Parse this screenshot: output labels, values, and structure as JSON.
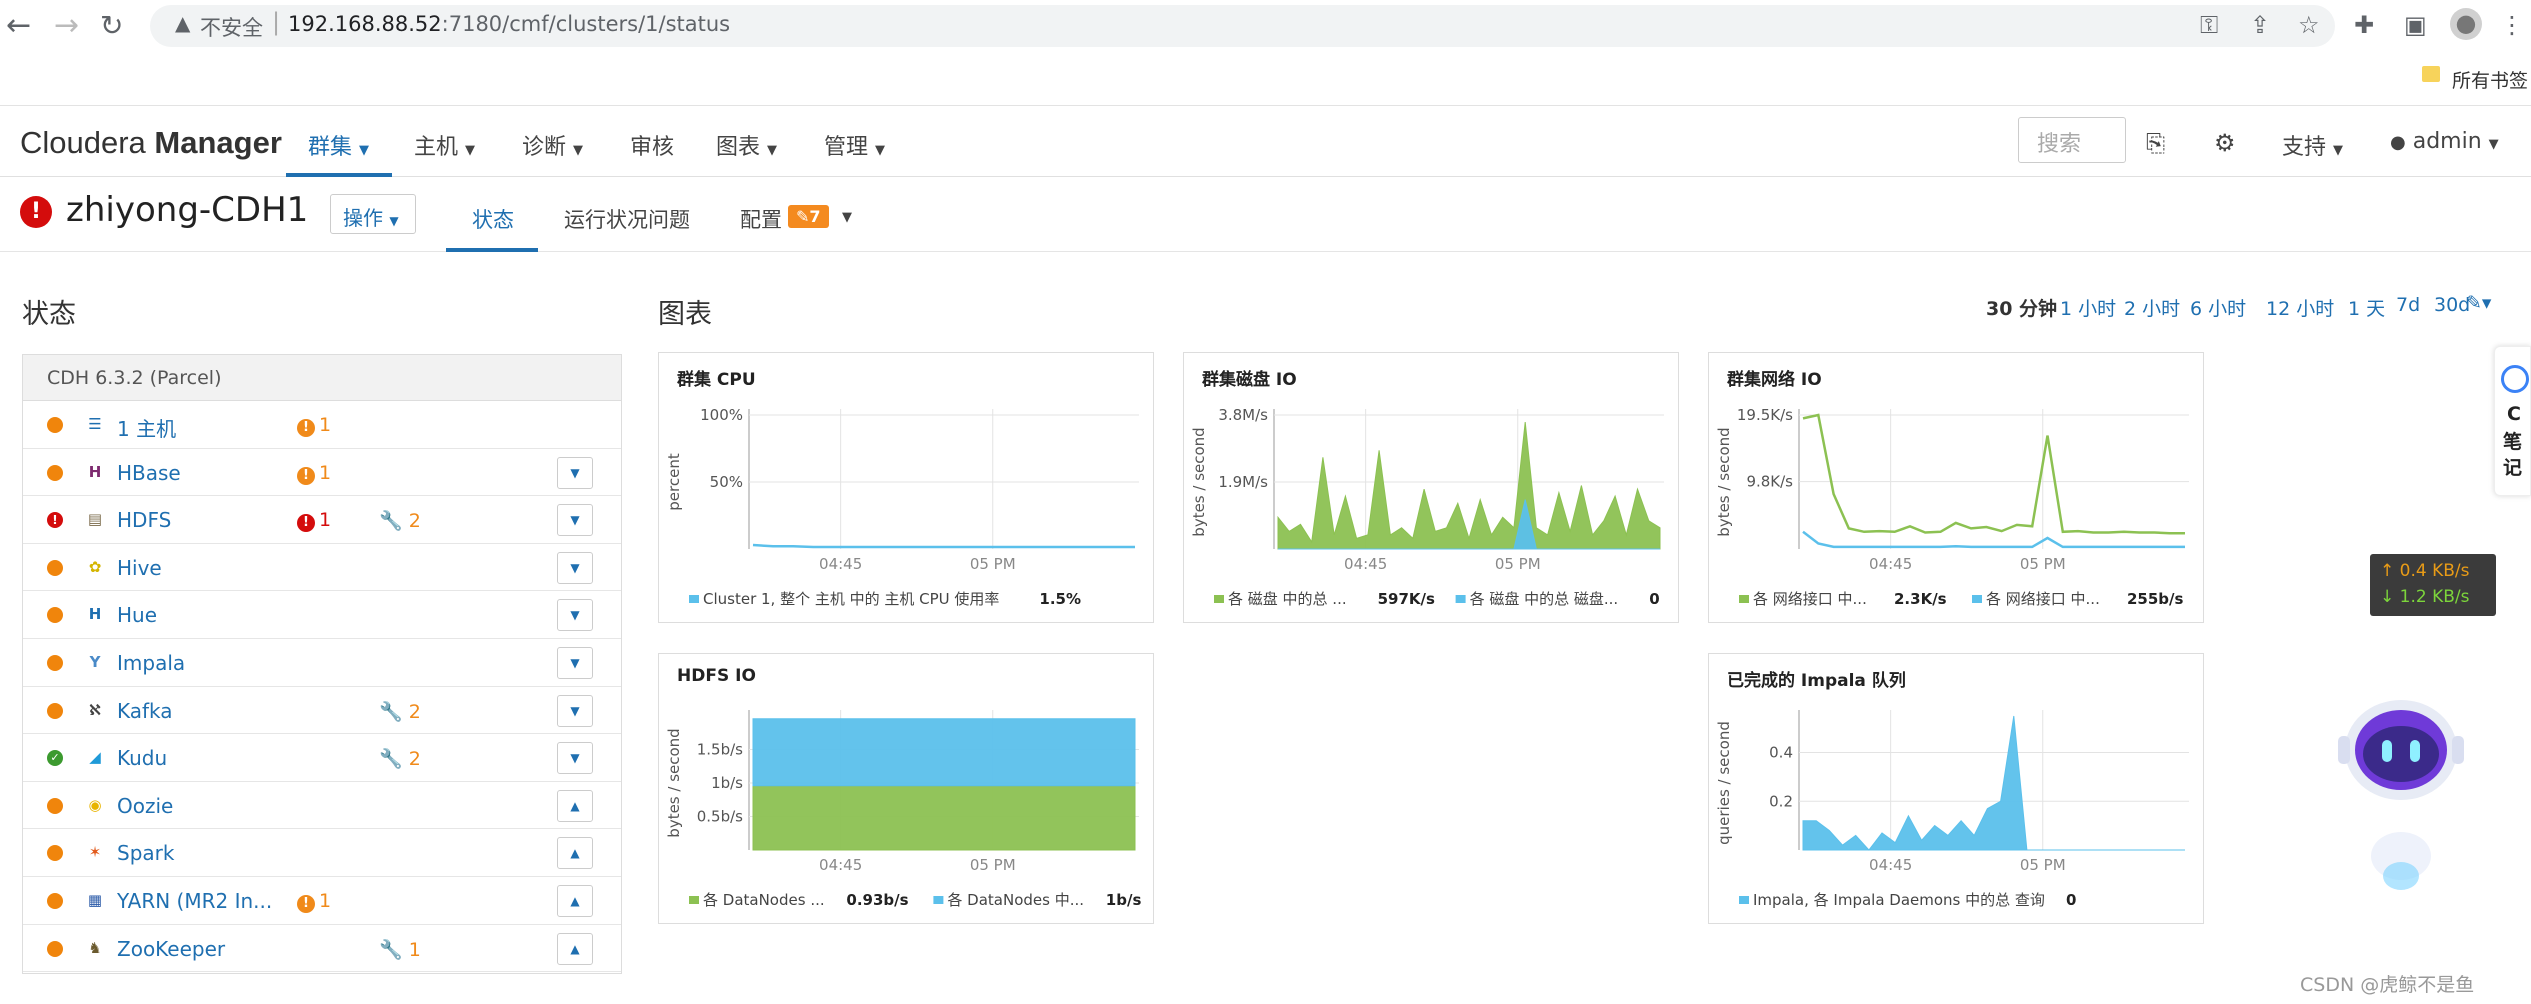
{
  "browser": {
    "security_label": "不安全",
    "url_host": "192.168.88.52",
    "url_path": ":7180/cmf/clusters/1/status",
    "bookmarks_label": "所有书签"
  },
  "topnav": {
    "brand_light": "Cloudera ",
    "brand_bold": "Manager",
    "items": [
      "群集",
      "主机",
      "诊断",
      "审核",
      "图表",
      "管理"
    ],
    "search_placeholder": "搜索",
    "support": "支持",
    "user": "admin"
  },
  "header": {
    "cluster_name": "zhiyong-CDH1",
    "actions_label": "操作",
    "tabs": [
      "状态",
      "运行状况问题",
      "配置"
    ],
    "config_badge": "7"
  },
  "status": {
    "title": "状态",
    "parcel": "CDH 6.3.2 (Parcel)",
    "services": [
      {
        "name": "1 主机",
        "dot": "#f0850c",
        "icon": "list-icon",
        "icon_color": "#1f6fb0",
        "alert": "1",
        "alert_type": "orange",
        "cfg": "",
        "btn": "",
        "icon_glyph": "☰"
      },
      {
        "name": "HBase",
        "dot": "#f0850c",
        "icon": "hbase-icon",
        "icon_color": "#7d2a6f",
        "alert": "1",
        "alert_type": "orange",
        "cfg": "",
        "btn": "▼",
        "icon_glyph": "H"
      },
      {
        "name": "HDFS",
        "dot": "#d40c0c",
        "icon": "hdfs-icon",
        "icon_color": "#7a6a4a",
        "alert": "1",
        "alert_type": "red",
        "cfg": "2",
        "btn": "▼",
        "icon_glyph": "▤"
      },
      {
        "name": "Hive",
        "dot": "#f0850c",
        "icon": "hive-icon",
        "icon_color": "#d4b500",
        "alert": "",
        "alert_type": "",
        "cfg": "",
        "btn": "▼",
        "icon_glyph": "✿"
      },
      {
        "name": "Hue",
        "dot": "#f0850c",
        "icon": "hue-icon",
        "icon_color": "#1f6fb0",
        "alert": "",
        "alert_type": "",
        "cfg": "",
        "btn": "▼",
        "icon_glyph": "H"
      },
      {
        "name": "Impala",
        "dot": "#f0850c",
        "icon": "impala-icon",
        "icon_color": "#4a8ac8",
        "alert": "",
        "alert_type": "",
        "cfg": "",
        "btn": "▼",
        "icon_glyph": "Y"
      },
      {
        "name": "Kafka",
        "dot": "#f0850c",
        "icon": "kafka-icon",
        "icon_color": "#444444",
        "alert": "",
        "alert_type": "",
        "cfg": "2",
        "btn": "▼",
        "icon_glyph": "ℵ"
      },
      {
        "name": "Kudu",
        "dot": "#3c9a2f",
        "icon": "kudu-icon",
        "icon_color": "#1f9ad8",
        "alert": "",
        "alert_type": "",
        "cfg": "2",
        "btn": "▼",
        "icon_glyph": "◢"
      },
      {
        "name": "Oozie",
        "dot": "#f0850c",
        "icon": "oozie-icon",
        "icon_color": "#e8b400",
        "alert": "",
        "alert_type": "",
        "cfg": "",
        "btn": "▲",
        "icon_glyph": "◉"
      },
      {
        "name": "Spark",
        "dot": "#f0850c",
        "icon": "spark-icon",
        "icon_color": "#e25a1c",
        "alert": "",
        "alert_type": "",
        "cfg": "",
        "btn": "▲",
        "icon_glyph": "✶"
      },
      {
        "name": "YARN (MR2 In...",
        "dot": "#f0850c",
        "icon": "yarn-icon",
        "icon_color": "#2a5aa8",
        "alert": "1",
        "alert_type": "orange",
        "cfg": "",
        "btn": "▲",
        "icon_glyph": "▦"
      },
      {
        "name": "ZooKeeper",
        "dot": "#f0850c",
        "icon": "zookeeper-icon",
        "icon_color": "#6b5a2e",
        "alert": "",
        "alert_type": "",
        "cfg": "1",
        "btn": "▲",
        "icon_glyph": "♞"
      }
    ]
  },
  "charts_panel": {
    "title": "图表",
    "time_ranges": [
      "30 分钟",
      "1 小时",
      "2 小时",
      "6 小时",
      "12 小时",
      "1 天",
      "7d",
      "30d"
    ],
    "active_range": "30 分钟"
  },
  "chart_data": [
    {
      "id": "cpu",
      "type": "line",
      "title": "群集 CPU",
      "ylabel": "percent",
      "yticks": [
        "100%",
        "50%"
      ],
      "ylim": [
        0,
        100
      ],
      "xticks": [
        "04:45",
        "05 PM"
      ],
      "series": [
        {
          "name": "Cluster 1, 整个 主机 中的 主机 CPU 使用率",
          "value_label": "1.5%",
          "color": "#5bc0eb",
          "values": [
            3,
            2,
            2,
            1.5,
            1.5,
            1.5,
            1.5,
            1.5,
            1.5,
            1.5,
            1.5,
            1.5,
            1.5,
            1.5,
            1.5,
            1.5,
            1.5,
            1.5,
            1.5,
            1.5
          ]
        }
      ]
    },
    {
      "id": "disk",
      "type": "area",
      "title": "群集磁盘 IO",
      "ylabel": "bytes / second",
      "yticks": [
        "3.8M/s",
        "1.9M/s"
      ],
      "ylim": [
        0,
        3.8
      ],
      "xticks": [
        "04:45",
        "05 PM"
      ],
      "series": [
        {
          "name": "各 磁盘 中的总 ...",
          "value_label": "597K/s",
          "color": "#8cc152",
          "values": [
            0.9,
            0.5,
            0.7,
            0.2,
            2.6,
            0.4,
            1.5,
            0.3,
            0.4,
            2.8,
            0.4,
            0.6,
            0.3,
            1.7,
            0.5,
            0.6,
            1.3,
            0.3,
            1.4,
            0.4,
            0.9,
            0.6,
            3.6,
            0.6,
            0.4,
            1.6,
            0.5,
            1.8,
            0.4,
            0.8,
            1.5,
            0.4,
            1.7,
            0.8,
            0.6
          ]
        },
        {
          "name": "各 磁盘 中的总 磁盘...",
          "value_label": "0",
          "color": "#5bc0eb",
          "values": [
            0,
            0,
            0,
            0,
            0,
            0,
            0,
            0,
            0,
            0,
            0,
            0,
            0,
            0,
            0,
            0,
            0,
            0,
            0,
            0,
            0,
            0,
            1.4,
            0,
            0,
            0,
            0,
            0,
            0,
            0,
            0,
            0,
            0,
            0,
            0
          ]
        }
      ]
    },
    {
      "id": "net",
      "type": "line",
      "title": "群集网络 IO",
      "ylabel": "bytes / second",
      "yticks": [
        "19.5K/s",
        "9.8K/s"
      ],
      "ylim": [
        0,
        19.5
      ],
      "xticks": [
        "04:45",
        "05 PM"
      ],
      "series": [
        {
          "name": "各 网络接口 中...",
          "value_label": "2.3K/s",
          "color": "#8cc152",
          "values": [
            19,
            19.5,
            8,
            3,
            2.5,
            2.6,
            2.5,
            3.3,
            2.4,
            2.5,
            3.8,
            3,
            3.2,
            2.6,
            3.5,
            3.3,
            16.5,
            2.5,
            2.6,
            2.4,
            2.4,
            2.5,
            2.4,
            2.4,
            2.3,
            2.3
          ]
        },
        {
          "name": "各 网络接口 中...",
          "value_label": "255b/s",
          "color": "#5bc0eb",
          "values": [
            2.5,
            0.8,
            0.3,
            0.3,
            0.3,
            0.3,
            0.3,
            0.3,
            0.3,
            0.3,
            0.4,
            0.3,
            0.3,
            0.3,
            0.3,
            0.3,
            1.6,
            0.3,
            0.3,
            0.3,
            0.3,
            0.3,
            0.3,
            0.3,
            0.3,
            0.3
          ]
        }
      ]
    },
    {
      "id": "hdfs",
      "type": "area",
      "title": "HDFS IO",
      "ylabel": "bytes / second",
      "yticks": [
        "1.5b/s",
        "1b/s",
        "0.5b/s"
      ],
      "ylim": [
        0,
        2
      ],
      "xticks": [
        "04:45",
        "05 PM"
      ],
      "series": [
        {
          "name": "各 DataNodes ...",
          "value_label": "0.93b/s",
          "color": "#8cc152",
          "values": [
            0.96,
            0.96,
            0.96,
            0.96,
            0.96,
            0.96,
            0.96,
            0.96,
            0.96,
            0.96,
            0.96,
            0.96
          ]
        },
        {
          "name": "各 DataNodes 中...",
          "value_label": "1b/s",
          "color": "#5bc0eb",
          "values": [
            1,
            1,
            1,
            1,
            1,
            1,
            1,
            1,
            1,
            1,
            1,
            1
          ]
        }
      ]
    },
    {
      "id": "impala",
      "type": "area",
      "title": "已完成的 Impala 队列",
      "ylabel": "queries / second",
      "yticks": [
        "0.4",
        "0.2"
      ],
      "ylim": [
        0,
        0.55
      ],
      "xticks": [
        "04:45",
        "05 PM"
      ],
      "series": [
        {
          "name": "Impala, 各 Impala Daemons 中的总 查询",
          "value_label": "0",
          "color": "#5bc0eb",
          "values": [
            0.12,
            0.12,
            0.08,
            0.02,
            0.06,
            0.0,
            0.07,
            0.03,
            0.14,
            0.04,
            0.1,
            0.06,
            0.12,
            0.06,
            0.17,
            0.2,
            0.55,
            0.0,
            0.0,
            0.0,
            0.0,
            0.0,
            0.0,
            0.0,
            0.0,
            0.0,
            0.0,
            0.0,
            0.0,
            0.0
          ]
        }
      ]
    }
  ],
  "net_widget": {
    "up": "↑ 0.4 KB/s",
    "down": "↓ 1.2 KB/s"
  },
  "note_tab": {
    "chars": [
      "C",
      "笔",
      "记"
    ]
  },
  "watermark": "CSDN @虎鲸不是鱼"
}
